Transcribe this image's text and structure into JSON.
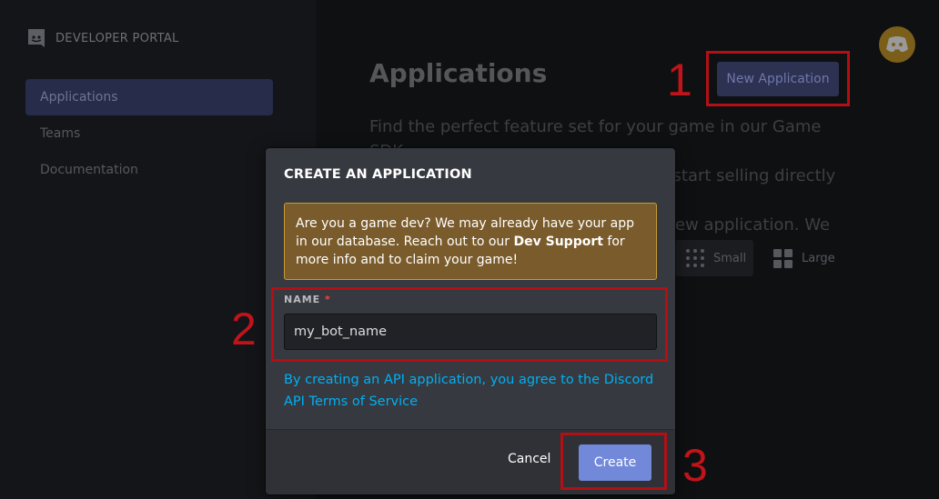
{
  "sidebar": {
    "brand": "DEVELOPER PORTAL",
    "items": [
      {
        "label": "Applications",
        "active": true
      },
      {
        "label": "Teams",
        "active": false
      },
      {
        "label": "Documentation",
        "active": false
      }
    ]
  },
  "main": {
    "title": "Applications",
    "new_app_label": "New Application",
    "intro_lines": [
      "Find the perfect feature set for your game in our Game SDK,",
      "and sign up for Server Commerce to start selling directly in",
      "ew application. We"
    ],
    "view_small": "Small",
    "view_large": "Large"
  },
  "modal": {
    "title": "CREATE AN APPLICATION",
    "notice_part1": "Are you a game dev? We may already have your app in our database. Reach out to our ",
    "notice_bold": "Dev Support",
    "notice_part2": " for more info and to claim your game!",
    "name_label": "NAME",
    "name_required": "*",
    "name_value": "my_bot_name",
    "tos_text": "By creating an API application, you agree to the Discord API Terms of Service",
    "cancel_label": "Cancel",
    "create_label": "Create"
  },
  "annotations": [
    "1",
    "2",
    "3"
  ],
  "colors": {
    "accent": "#7289da",
    "annotation_red": "#c0141a",
    "notice_bg": "#7a5c2c",
    "link": "#00b0f4"
  },
  "icons": [
    "discord-logo-icon",
    "grid-small-icon",
    "grid-large-icon",
    "discord-avatar-icon"
  ]
}
